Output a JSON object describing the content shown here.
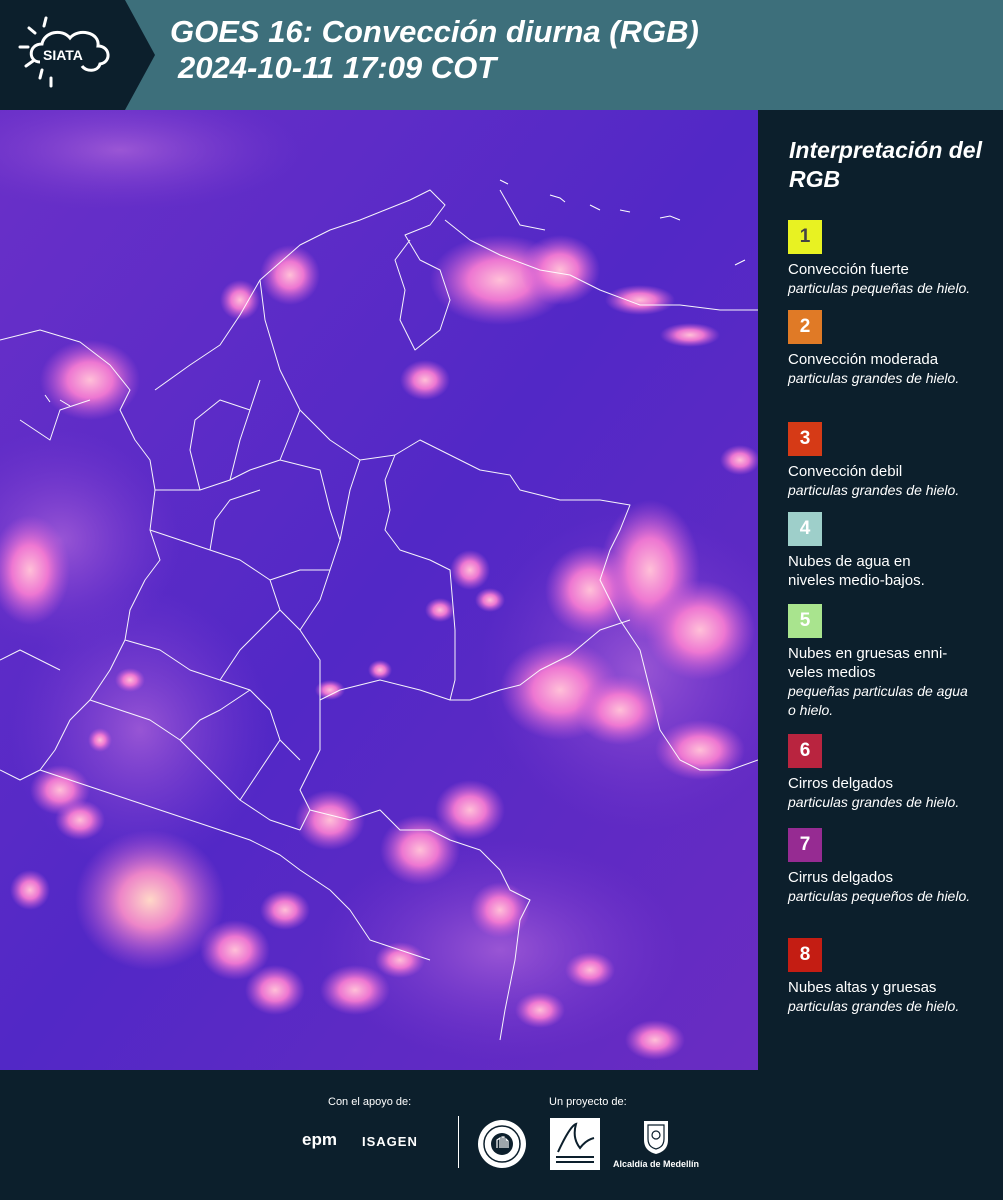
{
  "header": {
    "logo_text": "SIATA",
    "title_line1": "GOES 16: Convección diurna (RGB)",
    "title_line2": "2024-10-11 17:09 COT"
  },
  "legend": {
    "title": "Interpretación del RGB",
    "items": [
      {
        "number": "1",
        "color": "#e8f222",
        "label": "Convección fuerte",
        "desc": "particulas pequeñas de hielo."
      },
      {
        "number": "2",
        "color": "#e07a26",
        "label": "Convección moderada",
        "desc": "particulas grandes de hielo."
      },
      {
        "number": "3",
        "color": "#d63a16",
        "label": "Convección debil",
        "desc": "particulas grandes de hielo."
      },
      {
        "number": "4",
        "color": "#9ecfca",
        "label": "Nubes de agua en niveles medio-bajos.",
        "desc": ""
      },
      {
        "number": "5",
        "color": "#a9e48e",
        "label": "Nubes en gruesas enni-veles medios",
        "desc": "pequeñas particulas de agua o hielo."
      },
      {
        "number": "6",
        "color": "#b9243f",
        "label": "Cirros delgados",
        "desc": "particulas grandes de hielo."
      },
      {
        "number": "7",
        "color": "#962b92",
        "label": "Cirrus delgados",
        "desc": "particulas pequeños de hielo."
      },
      {
        "number": "8",
        "color": "#c41d13",
        "label": "Nubes altas y gruesas",
        "desc": "particulas grandes de hielo."
      }
    ]
  },
  "footer": {
    "support_label": "Con el apoyo de:",
    "project_label": "Un proyecto de:",
    "sponsor1": "epm",
    "sponsor2": "ISAGEN",
    "partner_alcaldia": "Alcaldía de Medellín"
  },
  "colors": {
    "header_bg": "#3d6f7b",
    "panel_bg": "#0c1f2c",
    "map_base": "#5a2bc4",
    "cloud_pink": "#f27ad0"
  }
}
